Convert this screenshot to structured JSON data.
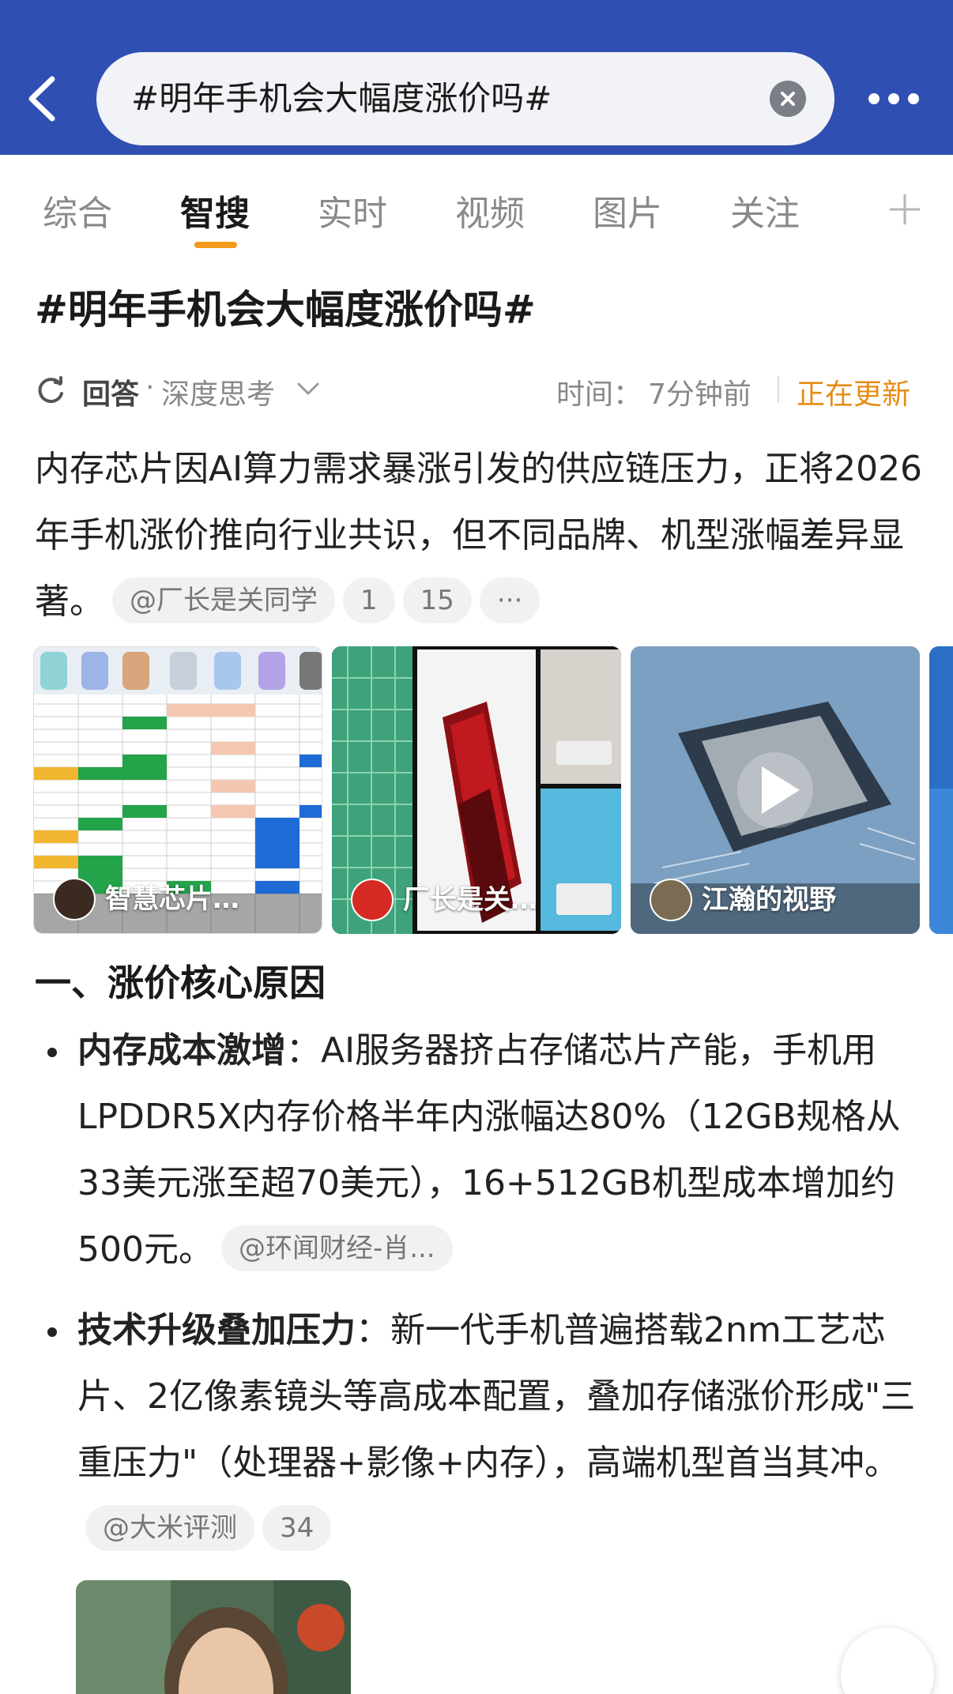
{
  "header": {
    "search_text": "#明年手机会大幅度涨价吗#",
    "back_icon": "chevron-left-icon",
    "clear_icon": "close-circle-icon",
    "more_icon": "more-dots-icon",
    "bg_color": "#2f4fb3"
  },
  "tabs": {
    "items": [
      "综合",
      "智搜",
      "实时",
      "视频",
      "图片",
      "关注"
    ],
    "active": "智搜",
    "accent_color": "#f39a1c",
    "plus_icon": "plus-icon"
  },
  "page_title": "#明年手机会大幅度涨价吗#",
  "meta": {
    "answer_label": "回答",
    "dot": "·",
    "mode_label": "深度思考",
    "time_label": "时间：",
    "time_value": "7分钟前",
    "updating_label": "正在更新",
    "updating_color": "#e58c15"
  },
  "intro": {
    "text": "内存芯片因AI算力需求暴涨引发的供应链压力，正将2026年手机涨价推向行业共识，但不同品牌、机型涨幅差异显著。",
    "source_chip": "@厂长是关同学",
    "count_chip_1": "1",
    "count_chip_2": "15",
    "more_chip": "···"
  },
  "carousel": {
    "cards": [
      {
        "label": "智慧芯片…"
      },
      {
        "label": "厂长是关…"
      },
      {
        "label": "江瀚的视野"
      }
    ]
  },
  "section": {
    "title": "一、涨价核心原因"
  },
  "bullets": [
    {
      "bold": "内存成本激增",
      "text": "：AI服务器挤占存储芯片产能，手机用LPDDR5X内存价格半年内涨幅达80%（12GB规格从33美元涨至超70美元），16+512GB机型成本增加约500元。",
      "chip": "@环闻财经-肖..."
    },
    {
      "bold": "技术升级叠加压力",
      "text": "：新一代手机普遍搭载2nm工艺芯片、2亿像素镜头等高成本配置，叠加存储涨价形成\"三重压力\"（处理器+影像+内存），高端机型首当其冲。",
      "chip": "@大米评测",
      "count": "34"
    }
  ]
}
